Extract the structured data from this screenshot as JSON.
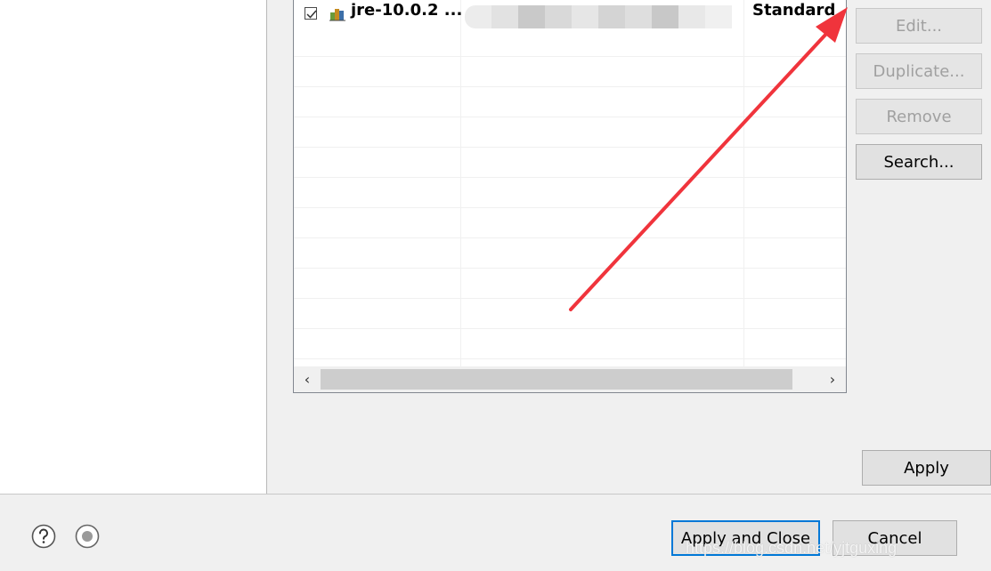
{
  "table": {
    "row": {
      "checked": true,
      "name": "jre-10.0.2 ...",
      "type": "Standard"
    },
    "scroll_left_glyph": "‹",
    "scroll_right_glyph": "›"
  },
  "side_buttons": {
    "edit": "Edit...",
    "duplicate": "Duplicate...",
    "remove": "Remove",
    "search": "Search..."
  },
  "buttons": {
    "apply": "Apply",
    "apply_and_close": "Apply and Close",
    "cancel": "Cancel"
  },
  "icons": {
    "help": "help-icon",
    "record": "record-icon",
    "jre": "jre-library-icon"
  },
  "colors": {
    "arrow": "#f0343c",
    "focus": "#0078d7"
  },
  "watermark": "https://blog.csdn.net/yjtguxing"
}
